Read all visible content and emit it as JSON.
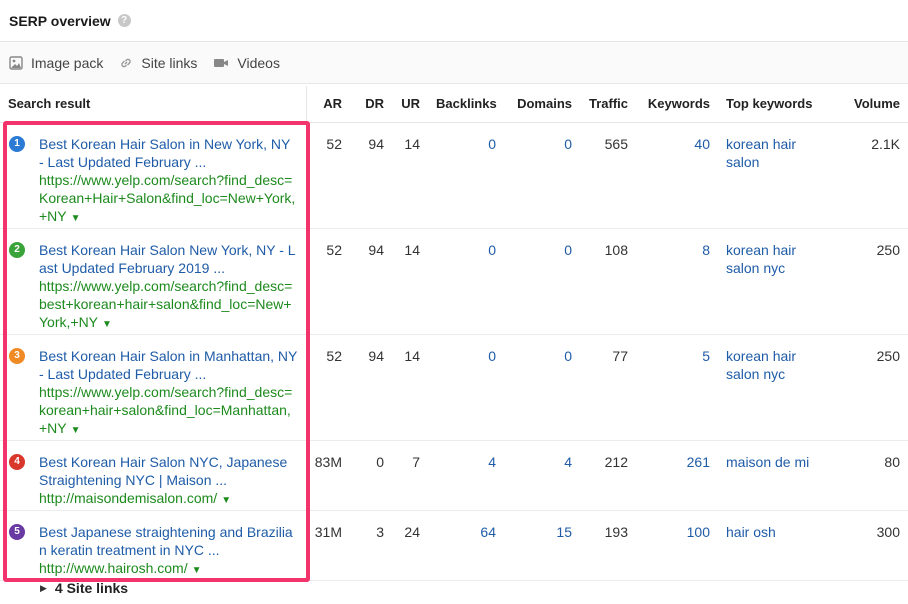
{
  "header": {
    "title": "SERP overview",
    "help": "?"
  },
  "features": [
    {
      "label": "Image pack",
      "icon": "image-icon"
    },
    {
      "label": "Site links",
      "icon": "link-icon"
    },
    {
      "label": "Videos",
      "icon": "video-icon"
    }
  ],
  "columns": {
    "search_result": "Search result",
    "ar": "AR",
    "dr": "DR",
    "ur": "UR",
    "backlinks": "Backlinks",
    "domains": "Domains",
    "traffic": "Traffic",
    "keywords": "Keywords",
    "top_keywords": "Top keywords",
    "volume": "Volume"
  },
  "rows": [
    {
      "pos": "1",
      "pos_color": "#2b7bd4",
      "title": "Best Korean Hair Salon in New York, NY - Last Updated February ...",
      "url": "https://www.yelp.com/search?find_desc=Korean+Hair+Salon&find_loc=New+York,+NY",
      "ar": "52",
      "dr": "94",
      "ur": "14",
      "backlinks": "0",
      "domains": "0",
      "traffic": "565",
      "keywords": "40",
      "top_keyword": "korean hair salon",
      "volume": "2.1K"
    },
    {
      "pos": "2",
      "pos_color": "#3aa33a",
      "title": "Best Korean Hair Salon New York, NY - Last Updated February 2019 ...",
      "url": "https://www.yelp.com/search?find_desc=best+korean+hair+salon&find_loc=New+York,+NY",
      "ar": "52",
      "dr": "94",
      "ur": "14",
      "backlinks": "0",
      "domains": "0",
      "traffic": "108",
      "keywords": "8",
      "top_keyword": "korean hair salon nyc",
      "volume": "250"
    },
    {
      "pos": "3",
      "pos_color": "#f08a24",
      "title": "Best Korean Hair Salon in Manhattan, NY - Last Updated February ...",
      "url": "https://www.yelp.com/search?find_desc=korean+hair+salon&find_loc=Manhattan,+NY",
      "ar": "52",
      "dr": "94",
      "ur": "14",
      "backlinks": "0",
      "domains": "0",
      "traffic": "77",
      "keywords": "5",
      "top_keyword": "korean hair salon nyc",
      "volume": "250"
    },
    {
      "pos": "4",
      "pos_color": "#d9372b",
      "title": "Best Korean Hair Salon NYC, Japanese Straightening NYC | Maison ...",
      "url": "http://maisondemisalon.com/",
      "ar": "83M",
      "dr": "0",
      "ur": "7",
      "backlinks": "4",
      "domains": "4",
      "traffic": "212",
      "keywords": "261",
      "top_keyword": "maison de mi",
      "volume": "80"
    },
    {
      "pos": "5",
      "pos_color": "#6a3aa3",
      "title": "Best Japanese straightening and Brazilian keratin treatment in NYC ...",
      "url": "http://www.hairosh.com/",
      "ar": "31M",
      "dr": "3",
      "ur": "24",
      "backlinks": "64",
      "domains": "15",
      "traffic": "193",
      "keywords": "100",
      "top_keyword": "hair osh",
      "volume": "300"
    }
  ],
  "site_links": "4 Site links"
}
